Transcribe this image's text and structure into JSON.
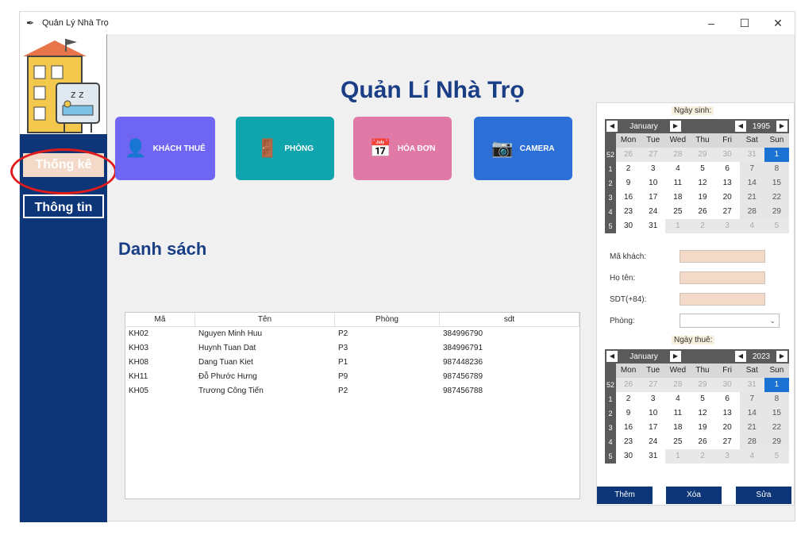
{
  "window": {
    "title": "Quản Lý Nhà Trọ",
    "controls": [
      "–",
      "☐",
      "✕"
    ]
  },
  "sidebar": {
    "stat_label": "Thống kê",
    "info_label": "Thông tin"
  },
  "header": {
    "title": "Quản Lí Nhà Trọ"
  },
  "cards": [
    {
      "label": "KHÁCH THUÊ",
      "icon": "add-user-icon"
    },
    {
      "label": "PHÒNG",
      "icon": "door-icon"
    },
    {
      "label": "HÓA ĐƠN",
      "icon": "calendar-icon"
    },
    {
      "label": "CAMERA",
      "icon": "camera-icon"
    }
  ],
  "list": {
    "title": "Danh sách",
    "columns": [
      "Mã",
      "Tên",
      "Phòng",
      "sdt"
    ],
    "rows": [
      [
        "KH02",
        "Nguyen Minh Huu",
        "P2",
        "384996790"
      ],
      [
        "KH03",
        "Huynh Tuan Dat",
        "P3",
        "384996791"
      ],
      [
        "KH08",
        "Dang Tuan Kiet",
        "P1",
        "987448236"
      ],
      [
        "KH11",
        "Đỗ Phước Hưng",
        "P9",
        "987456789"
      ],
      [
        "KH05",
        "Trương Công Tiến",
        "P2",
        "987456788"
      ]
    ]
  },
  "form": {
    "birth_label": "Ngày sinh:",
    "birth_cal": {
      "month": "January",
      "year": "1995"
    },
    "fields": [
      "Mã khách:",
      "Họ tên:",
      "SDT(+84):",
      "Phòng:"
    ],
    "rent_label": "Ngày thuê:",
    "rent_cal": {
      "month": "January",
      "year": "2023"
    },
    "weekdays": [
      "Mon",
      "Tue",
      "Wed",
      "Thu",
      "Fri",
      "Sat",
      "Sun"
    ],
    "week_numbers": [
      "52",
      "1",
      "2",
      "3",
      "4",
      "5"
    ],
    "combo_arrow": "⌄"
  },
  "actions": {
    "add": "Thêm",
    "delete": "Xóa",
    "edit": "Sửa"
  }
}
